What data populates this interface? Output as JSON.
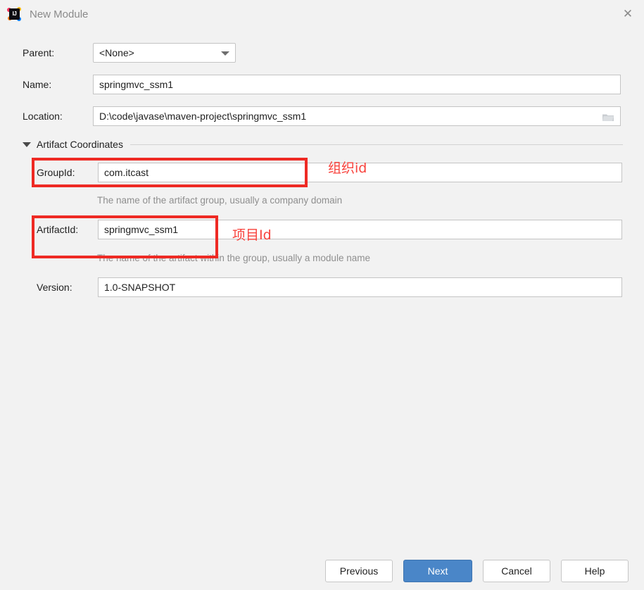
{
  "window": {
    "title": "New Module",
    "app_icon": "intellij-idea-icon",
    "icon_text": "IJ",
    "close_label": "✕"
  },
  "form": {
    "parent": {
      "label": "Parent:",
      "value": "<None>",
      "dropdown_icon": "chevron-down-icon"
    },
    "name": {
      "label": "Name:",
      "value": "springmvc_ssm1"
    },
    "location": {
      "label": "Location:",
      "value": "D:\\code\\javase\\maven-project\\springmvc_ssm1",
      "browse_icon": "folder-icon"
    }
  },
  "section": {
    "title": "Artifact Coordinates",
    "expanded": true,
    "toggle_icon": "triangle-down-icon"
  },
  "coordinates": {
    "group_id": {
      "label": "GroupId:",
      "value": "com.itcast",
      "hint": "The name of the artifact group, usually a company domain"
    },
    "artifact_id": {
      "label": "ArtifactId:",
      "value": "springmvc_ssm1",
      "hint": "The name of the artifact within the group, usually a module name"
    },
    "version": {
      "label": "Version:",
      "value": "1.0-SNAPSHOT"
    }
  },
  "annotations": {
    "color": "#f8423c",
    "group_id_note": "组织id",
    "artifact_id_note": "项目Id"
  },
  "buttons": {
    "previous": "Previous",
    "next": "Next",
    "cancel": "Cancel",
    "help": "Help",
    "primary_color": "#4a86c8"
  }
}
